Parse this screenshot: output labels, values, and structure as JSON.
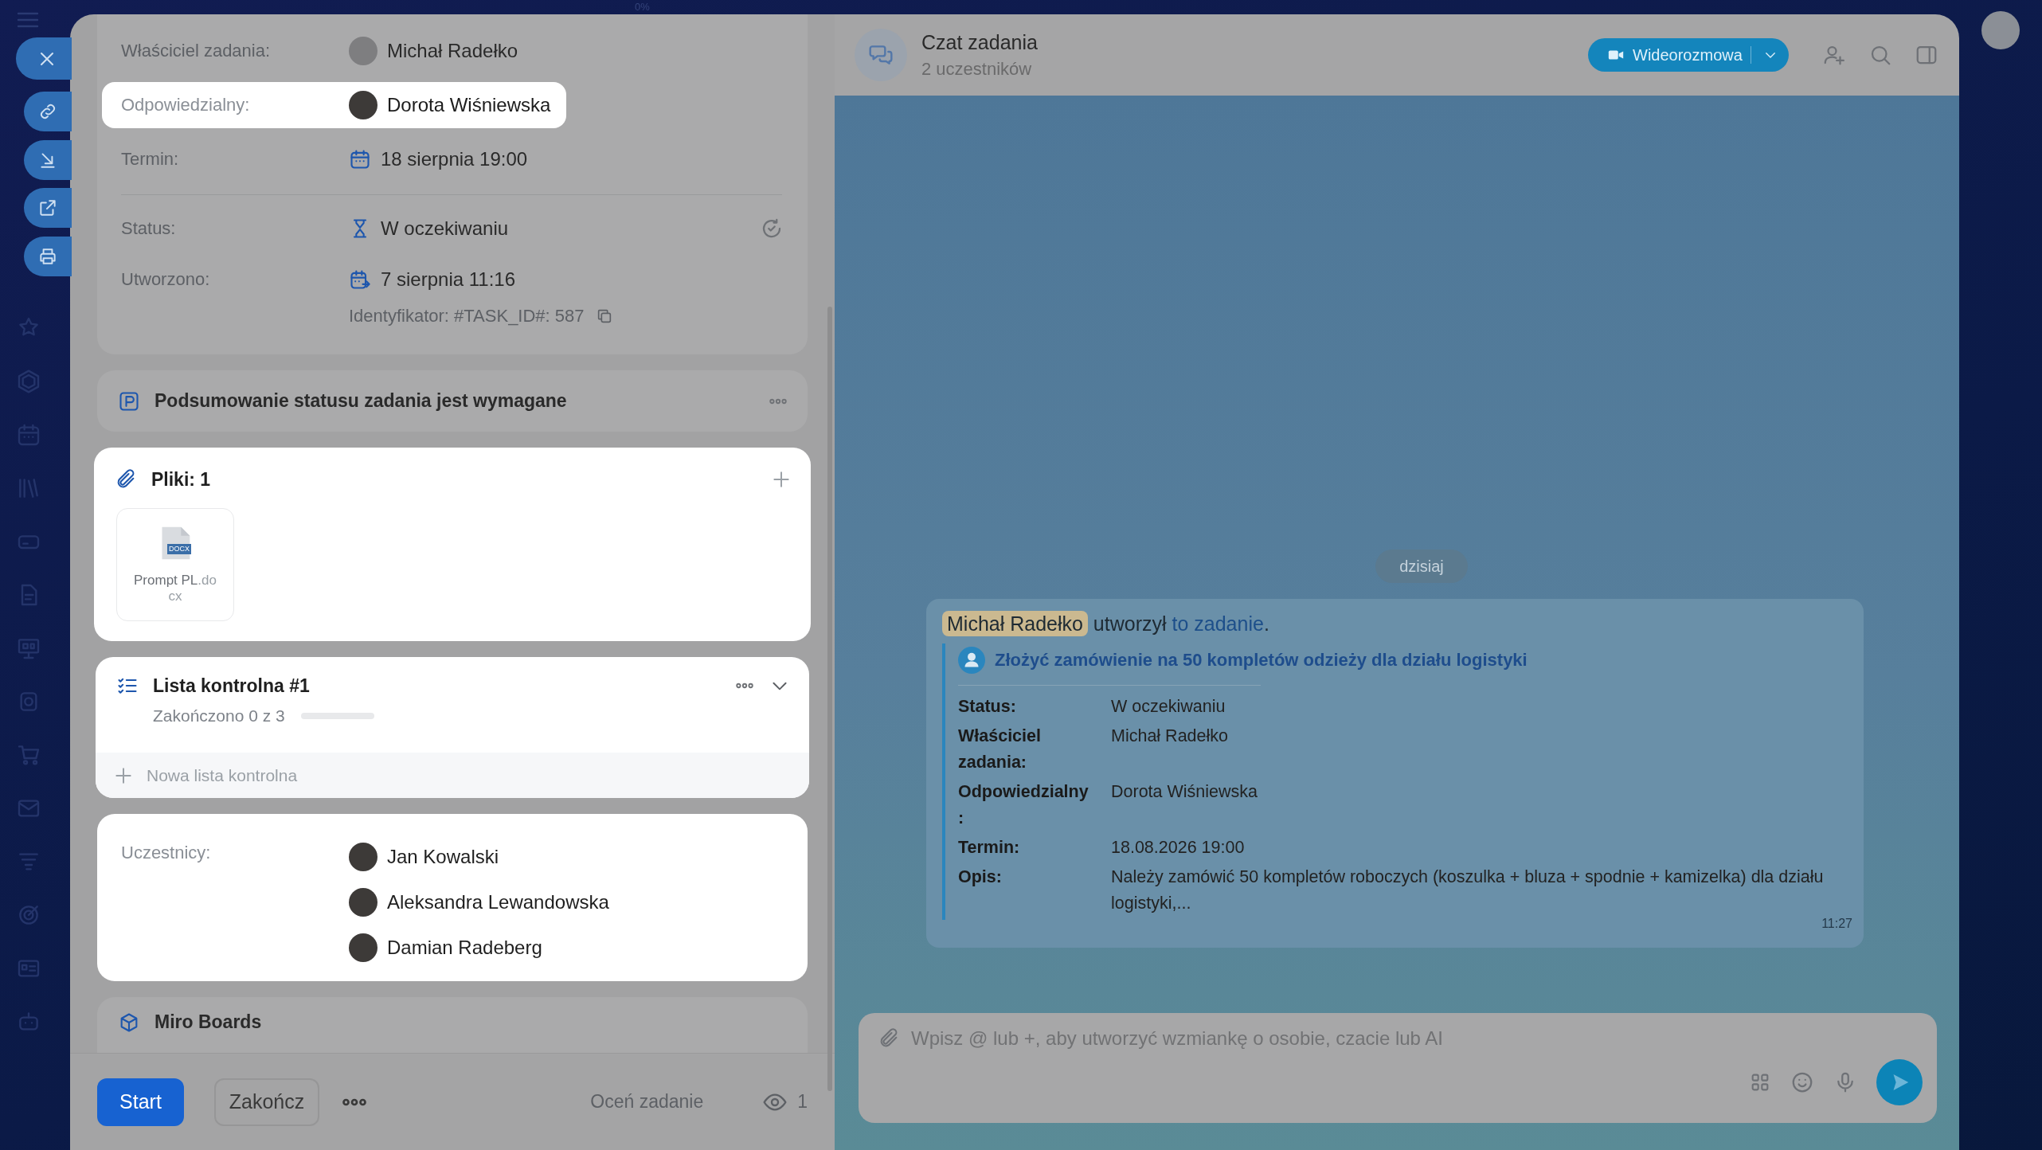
{
  "top_bar": {
    "progress": "0%"
  },
  "task_panel": {
    "fields": [
      {
        "kind": "person",
        "label": "Właściciel zadania:",
        "value": "Michał Radełko",
        "highlighted": false
      },
      {
        "kind": "person",
        "label": "Odpowiedzialny:",
        "value": "Dorota Wiśniewska",
        "highlighted": true
      },
      {
        "kind": "deadline",
        "label": "Termin:",
        "value": "18 sierpnia 19:00",
        "highlighted": false
      },
      {
        "kind": "status",
        "label": "Status:",
        "value": "W oczekiwaniu",
        "highlighted": false
      },
      {
        "kind": "created",
        "label": "Utworzono:",
        "value": "7 sierpnia 11:16",
        "highlighted": false
      }
    ],
    "identifier": "Identyfikator: #TASK_ID#: 587",
    "summary_card": {
      "title": "Podsumowanie statusu zadania jest wymagane",
      "highlighted": false
    },
    "files_card": {
      "title": "Pliki: 1",
      "highlighted": true,
      "files": [
        {
          "name": "Prompt PL",
          "extension": ".docx",
          "badge": "DOCX"
        }
      ]
    },
    "checklist_card": {
      "title": "Lista kontrolna #1",
      "progress_text": "Zakończono 0 z 3",
      "level": 0,
      "add_label": "Nowa lista kontrolna",
      "highlighted": true
    },
    "participants_card": {
      "label": "Uczestnicy:",
      "highlighted": true,
      "people": [
        "Jan Kowalski",
        "Aleksandra Lewandowska",
        "Damian Radeberg"
      ]
    },
    "miro_card": {
      "title": "Miro Boards",
      "highlighted": false
    },
    "footer": {
      "start": "Start",
      "finish": "Zakończ",
      "rate": "Oceń zadanie",
      "views": "1"
    }
  },
  "chat": {
    "title": "Czat zadania",
    "subtitle": "2 uczestników",
    "call_button": "Wideorozmowa",
    "date_pill": "dzisiaj",
    "message": {
      "author": "Michał Radełko",
      "action": " utworzył ",
      "link": "to zadanie",
      "end": ".",
      "task_title": "Złożyć zamówienie na 50 kompletów odzieży dla działu logistyki",
      "rows": [
        {
          "label": "Status:",
          "value": "W oczekiwaniu"
        },
        {
          "label": "Właściciel zadania:",
          "value": "Michał Radełko"
        },
        {
          "label": "Odpowiedzialny:",
          "value": "Dorota Wiśniewska"
        },
        {
          "label": "Termin:",
          "value": "18.08.2026 19:00"
        },
        {
          "label": "Opis:",
          "value": "Należy zamówić 50 kompletów roboczych (koszulka + bluza + spodnie + kamizelka) dla działu logistyki,..."
        }
      ],
      "time": "11:27"
    },
    "input": {
      "placeholder": "Wpisz @ lub +, aby utworzyć wzmiankę o osobie, czacie lub AI"
    }
  }
}
